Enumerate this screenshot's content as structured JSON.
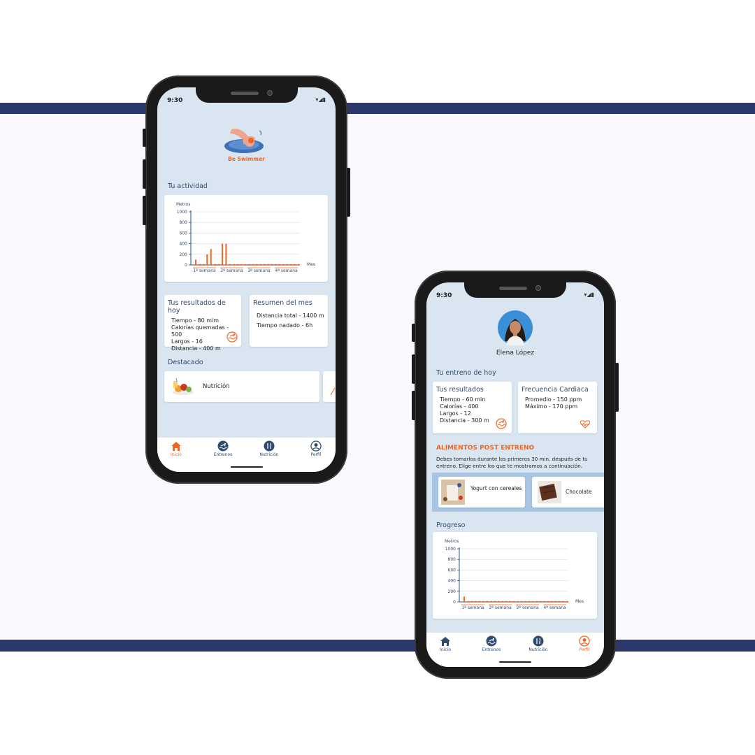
{
  "phone1": {
    "status_time": "9:30",
    "logo_text": "Be Swimmer",
    "activity_title": "Tu actividad",
    "chart": {
      "y_label": "Metros",
      "x_unit": "Mes",
      "y_ticks": [
        "1000",
        "800",
        "600",
        "400",
        "200",
        "0"
      ],
      "x_labels": [
        "1ª semana",
        "2ª semana",
        "3ª semana",
        "4ª semana"
      ]
    },
    "results_card": {
      "title": "Tus resultados de hoy",
      "lines": [
        "Tiempo - 80 mim",
        "Calorías quemadas - 500",
        "Largos - 16",
        "Distancia - 400 m"
      ]
    },
    "summary_card": {
      "title": "Resumen del mes",
      "lines": [
        "Distancia total - 1400 m",
        "Tiempo nadado - 6h"
      ]
    },
    "featured_title": "Destacado",
    "featured_item": "Nutrición",
    "nav": [
      "Inicio",
      "Entrenos",
      "Nutrición",
      "Perfil"
    ]
  },
  "phone2": {
    "status_time": "9:30",
    "user_name": "Elena López",
    "today_title": "Tu entreno de hoy",
    "results_card": {
      "title": "Tus resultados",
      "lines": [
        "Tiempo - 60 min",
        "Calorías - 400",
        "Largos - 12",
        "Distancia - 300 m"
      ]
    },
    "heart_card": {
      "title": "Frecuencia Cardiaca",
      "lines": [
        "Promedio - 150 ppm",
        "Máximo - 170 ppm"
      ]
    },
    "food_title": "ALIMENTOS POST ENTRENO",
    "food_text": "Debes tomarlos durante los primeros 30 min. después de tu entreno. Elige entre los que te mostramos a continuación.",
    "foods": [
      "Yogurt con cereales",
      "Chocolate"
    ],
    "progress_title": "Progreso",
    "chart": {
      "y_label": "Metros",
      "x_unit": "Mes",
      "y_ticks": [
        "1000",
        "800",
        "600",
        "400",
        "200",
        "0"
      ],
      "x_labels": [
        "1ª semana",
        "2ª semana",
        "3ª semana",
        "4ª semana"
      ]
    },
    "nav": [
      "Inicio",
      "Entrenos",
      "Nutrición",
      "Perfil"
    ]
  },
  "chart_data": [
    {
      "type": "bar",
      "ylabel": "Metros",
      "xlabel": "Mes",
      "categories": [
        "1ª semana",
        "2ª semana",
        "3ª semana",
        "4ª semana"
      ],
      "ylim": [
        0,
        1000
      ],
      "values": [
        100,
        0,
        0,
        200,
        300,
        0,
        0,
        400,
        400,
        0,
        0,
        0,
        0,
        0,
        0,
        0,
        0,
        0,
        0,
        0,
        0,
        0,
        0,
        0,
        0,
        0,
        0,
        0
      ],
      "colors": {
        "bar": "#f0651f",
        "axis": "#2f4b70"
      }
    },
    {
      "type": "bar",
      "ylabel": "Metros",
      "xlabel": "Mes",
      "categories": [
        "1ª semana",
        "2ª semana",
        "3ª semana",
        "4ª semana"
      ],
      "ylim": [
        0,
        1000
      ],
      "values": [
        100,
        0,
        0,
        0,
        0,
        0,
        0,
        0,
        0,
        0,
        0,
        0,
        0,
        0,
        0,
        0,
        0,
        0,
        0,
        0,
        0,
        0,
        0,
        0,
        0,
        0,
        0,
        0
      ],
      "colors": {
        "bar": "#f0651f",
        "axis": "#2f4b70"
      }
    }
  ],
  "colors": {
    "accent": "#f0651f",
    "navy": "#2b386b",
    "screen_bg": "#d9e6f1",
    "text_blue": "#2f4b70"
  }
}
